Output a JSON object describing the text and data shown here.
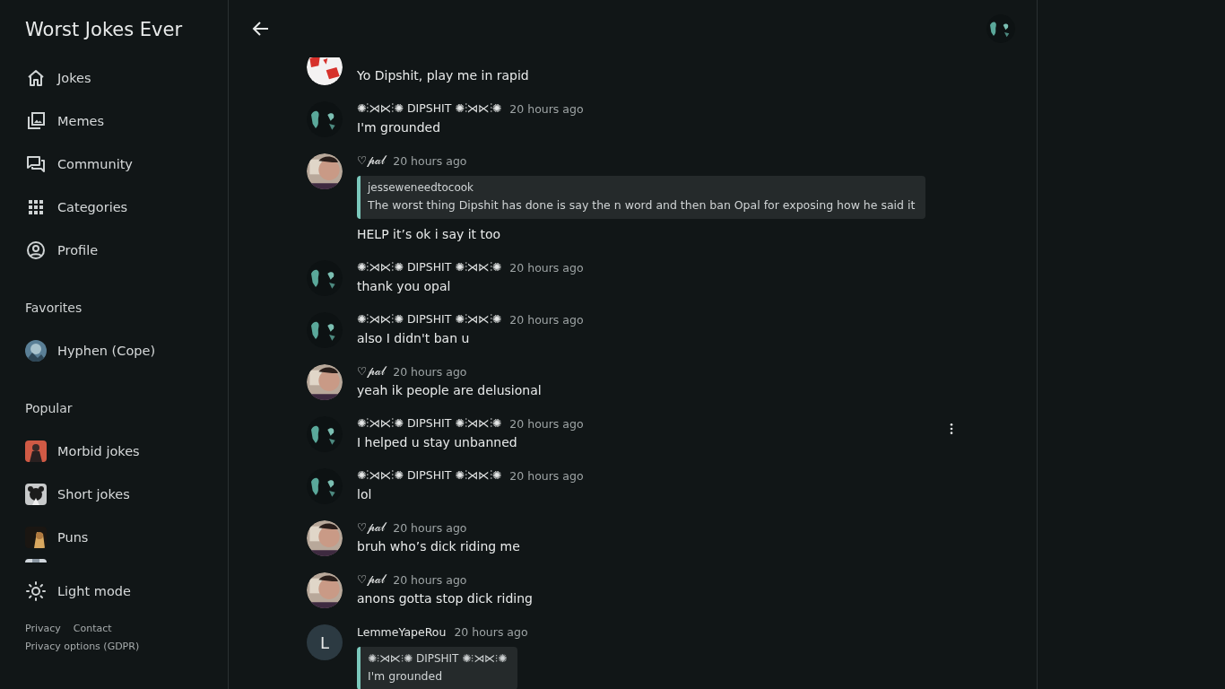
{
  "sidebar": {
    "title": "Worst Jokes Ever",
    "nav": [
      {
        "kind": "home",
        "label": "Jokes"
      },
      {
        "kind": "gallery",
        "label": "Memes"
      },
      {
        "kind": "forum",
        "label": "Community"
      },
      {
        "kind": "grid",
        "label": "Categories"
      },
      {
        "kind": "account",
        "label": "Profile"
      }
    ],
    "favorites": {
      "heading": "Favorites",
      "items": [
        {
          "label": "Hyphen (Cope)"
        }
      ]
    },
    "popular": {
      "heading": "Popular",
      "items": [
        {
          "label": "Morbid jokes"
        },
        {
          "label": "Short jokes"
        },
        {
          "label": "Puns"
        },
        {
          "kind": "picture"
        }
      ]
    },
    "theme_toggle": {
      "label": "Light mode"
    },
    "footer_links": [
      "Privacy",
      "Contact",
      "Privacy options (GDPR)"
    ]
  },
  "header": {
    "back": true
  },
  "messages": [
    {
      "kind": "red",
      "body": "Yo Dipshit, play me in rapid"
    },
    {
      "kind": "dark",
      "author": "✺⫶⋊⋉⫶✺ DIPSHIT ✺⫶⋊⋉⫶✺",
      "time": "20 hours ago",
      "body": "I'm grounded"
    },
    {
      "kind": "beige",
      "author": "♡𝓅𝒶𝓁",
      "time": "20 hours ago",
      "quote": {
        "author": "jesseweneedtocook",
        "body": "The worst thing Dipshit has done is say the n word and then ban Opal for exposing how he said it"
      },
      "body": "HELP it’s ok i say it too"
    },
    {
      "kind": "dark",
      "author": "✺⫶⋊⋉⫶✺ DIPSHIT ✺⫶⋊⋉⫶✺",
      "time": "20 hours ago",
      "body": "thank you opal"
    },
    {
      "kind": "dark",
      "author": "✺⫶⋊⋉⫶✺ DIPSHIT ✺⫶⋊⋉⫶✺",
      "time": "20 hours ago",
      "body": "also I didn't ban u"
    },
    {
      "kind": "beige",
      "author": "♡𝓅𝒶𝓁",
      "time": "20 hours ago",
      "body": "yeah ik people are delusional"
    },
    {
      "kind": "dark",
      "author": "✺⫶⋊⋉⫶✺ DIPSHIT ✺⫶⋊⋉⫶✺",
      "time": "20 hours ago",
      "body": "I helped u stay unbanned",
      "menu": true
    },
    {
      "kind": "dark",
      "author": "✺⫶⋊⋉⫶✺ DIPSHIT ✺⫶⋊⋉⫶✺",
      "time": "20 hours ago",
      "body": "lol"
    },
    {
      "kind": "beige",
      "author": "♡𝓅𝒶𝓁",
      "time": "20 hours ago",
      "body": "bruh who’s dick riding me"
    },
    {
      "kind": "beige",
      "author": "♡𝓅𝒶𝓁",
      "time": "20 hours ago",
      "body": "anons gotta stop dick riding"
    },
    {
      "kind": "letter",
      "letter": "L",
      "author": "LemmeYapeRou",
      "time": "20 hours ago",
      "quote": {
        "author": "✺⫶⋊⋉⫶✺ DIPSHIT ✺⫶⋊⋉⫶✺",
        "body": "I'm grounded"
      }
    }
  ]
}
